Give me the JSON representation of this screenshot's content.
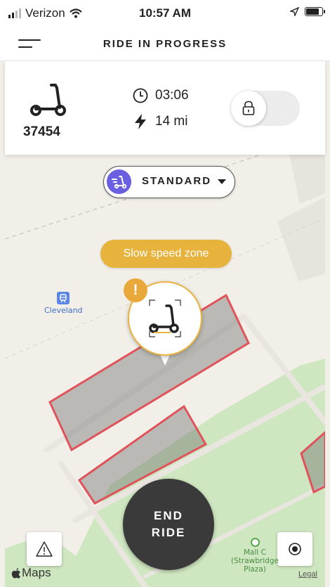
{
  "status_bar": {
    "carrier": "Verizon",
    "time": "10:57 AM",
    "signal_bars_active": 2,
    "signal_bars_total": 4,
    "icons": [
      "signal-icon",
      "wifi-icon",
      "location-arrow-icon",
      "battery-icon"
    ]
  },
  "header": {
    "title": "RIDE IN PROGRESS",
    "menu_icon": "menu-icon"
  },
  "ride": {
    "scooter_id": "37454",
    "duration": "03:06",
    "range": "14 mi",
    "icons": [
      "scooter-icon",
      "clock-icon",
      "bolt-icon",
      "lock-icon"
    ],
    "lock_toggle_on": false
  },
  "map": {
    "mode": "STANDARD",
    "zone_notice": "Slow speed zone",
    "station_label": "Cleveland",
    "poi_label": "Mall C\n(Strawbridge\nPlaza)",
    "brand": "Maps",
    "legal": "Legal"
  },
  "actions": {
    "end_ride_line1": "END",
    "end_ride_line2": "RIDE"
  },
  "colors": {
    "accent_yellow": "#e8b33c",
    "mode_purple": "#6a5fe0",
    "zone_red": "#e0535a",
    "park_green": "#cfe7c0",
    "end_ride_dark": "#3a3a3a"
  }
}
